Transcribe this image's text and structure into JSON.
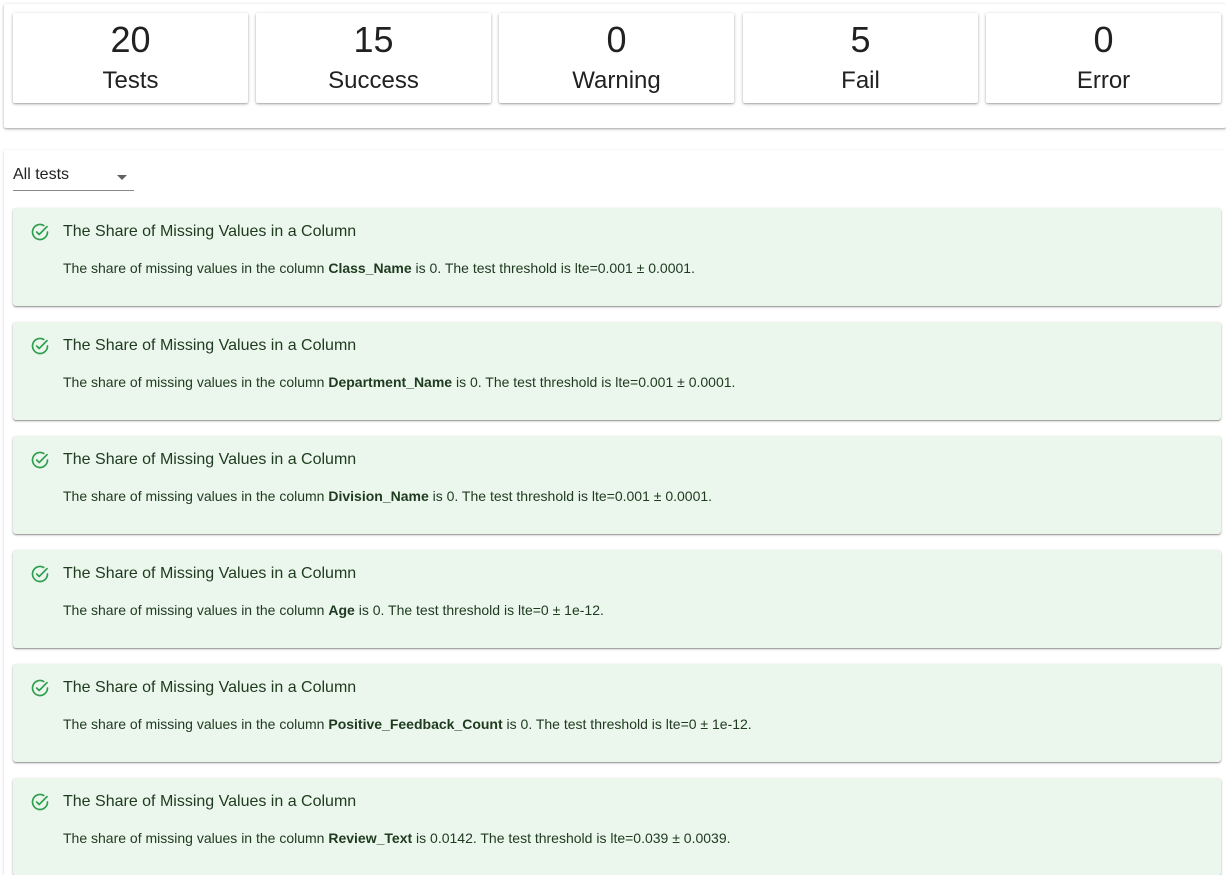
{
  "summary": {
    "stats": [
      {
        "value": "20",
        "label": "Tests"
      },
      {
        "value": "15",
        "label": "Success"
      },
      {
        "value": "0",
        "label": "Warning"
      },
      {
        "value": "5",
        "label": "Fail"
      },
      {
        "value": "0",
        "label": "Error"
      }
    ]
  },
  "filter": {
    "selected": "All tests"
  },
  "status_icon": {
    "name": "check-circle-icon",
    "color": "#2e9e4f"
  },
  "colors": {
    "success_card_bg": "#ebf6ec",
    "success_text": "#1e3a1f"
  },
  "tests": [
    {
      "title": "The Share of Missing Values in a Column",
      "desc_prefix": "The share of missing values in the column ",
      "column": "Class_Name",
      "desc_suffix": " is 0. The test threshold is lte=0.001 ± 0.0001."
    },
    {
      "title": "The Share of Missing Values in a Column",
      "desc_prefix": "The share of missing values in the column ",
      "column": "Department_Name",
      "desc_suffix": " is 0. The test threshold is lte=0.001 ± 0.0001."
    },
    {
      "title": "The Share of Missing Values in a Column",
      "desc_prefix": "The share of missing values in the column ",
      "column": "Division_Name",
      "desc_suffix": " is 0. The test threshold is lte=0.001 ± 0.0001."
    },
    {
      "title": "The Share of Missing Values in a Column",
      "desc_prefix": "The share of missing values in the column ",
      "column": "Age",
      "desc_suffix": " is 0. The test threshold is lte=0 ± 1e-12."
    },
    {
      "title": "The Share of Missing Values in a Column",
      "desc_prefix": "The share of missing values in the column ",
      "column": "Positive_Feedback_Count",
      "desc_suffix": " is 0. The test threshold is lte=0 ± 1e-12."
    },
    {
      "title": "The Share of Missing Values in a Column",
      "desc_prefix": "The share of missing values in the column ",
      "column": "Review_Text",
      "desc_suffix": " is 0.0142. The test threshold is lte=0.039 ± 0.0039."
    }
  ]
}
